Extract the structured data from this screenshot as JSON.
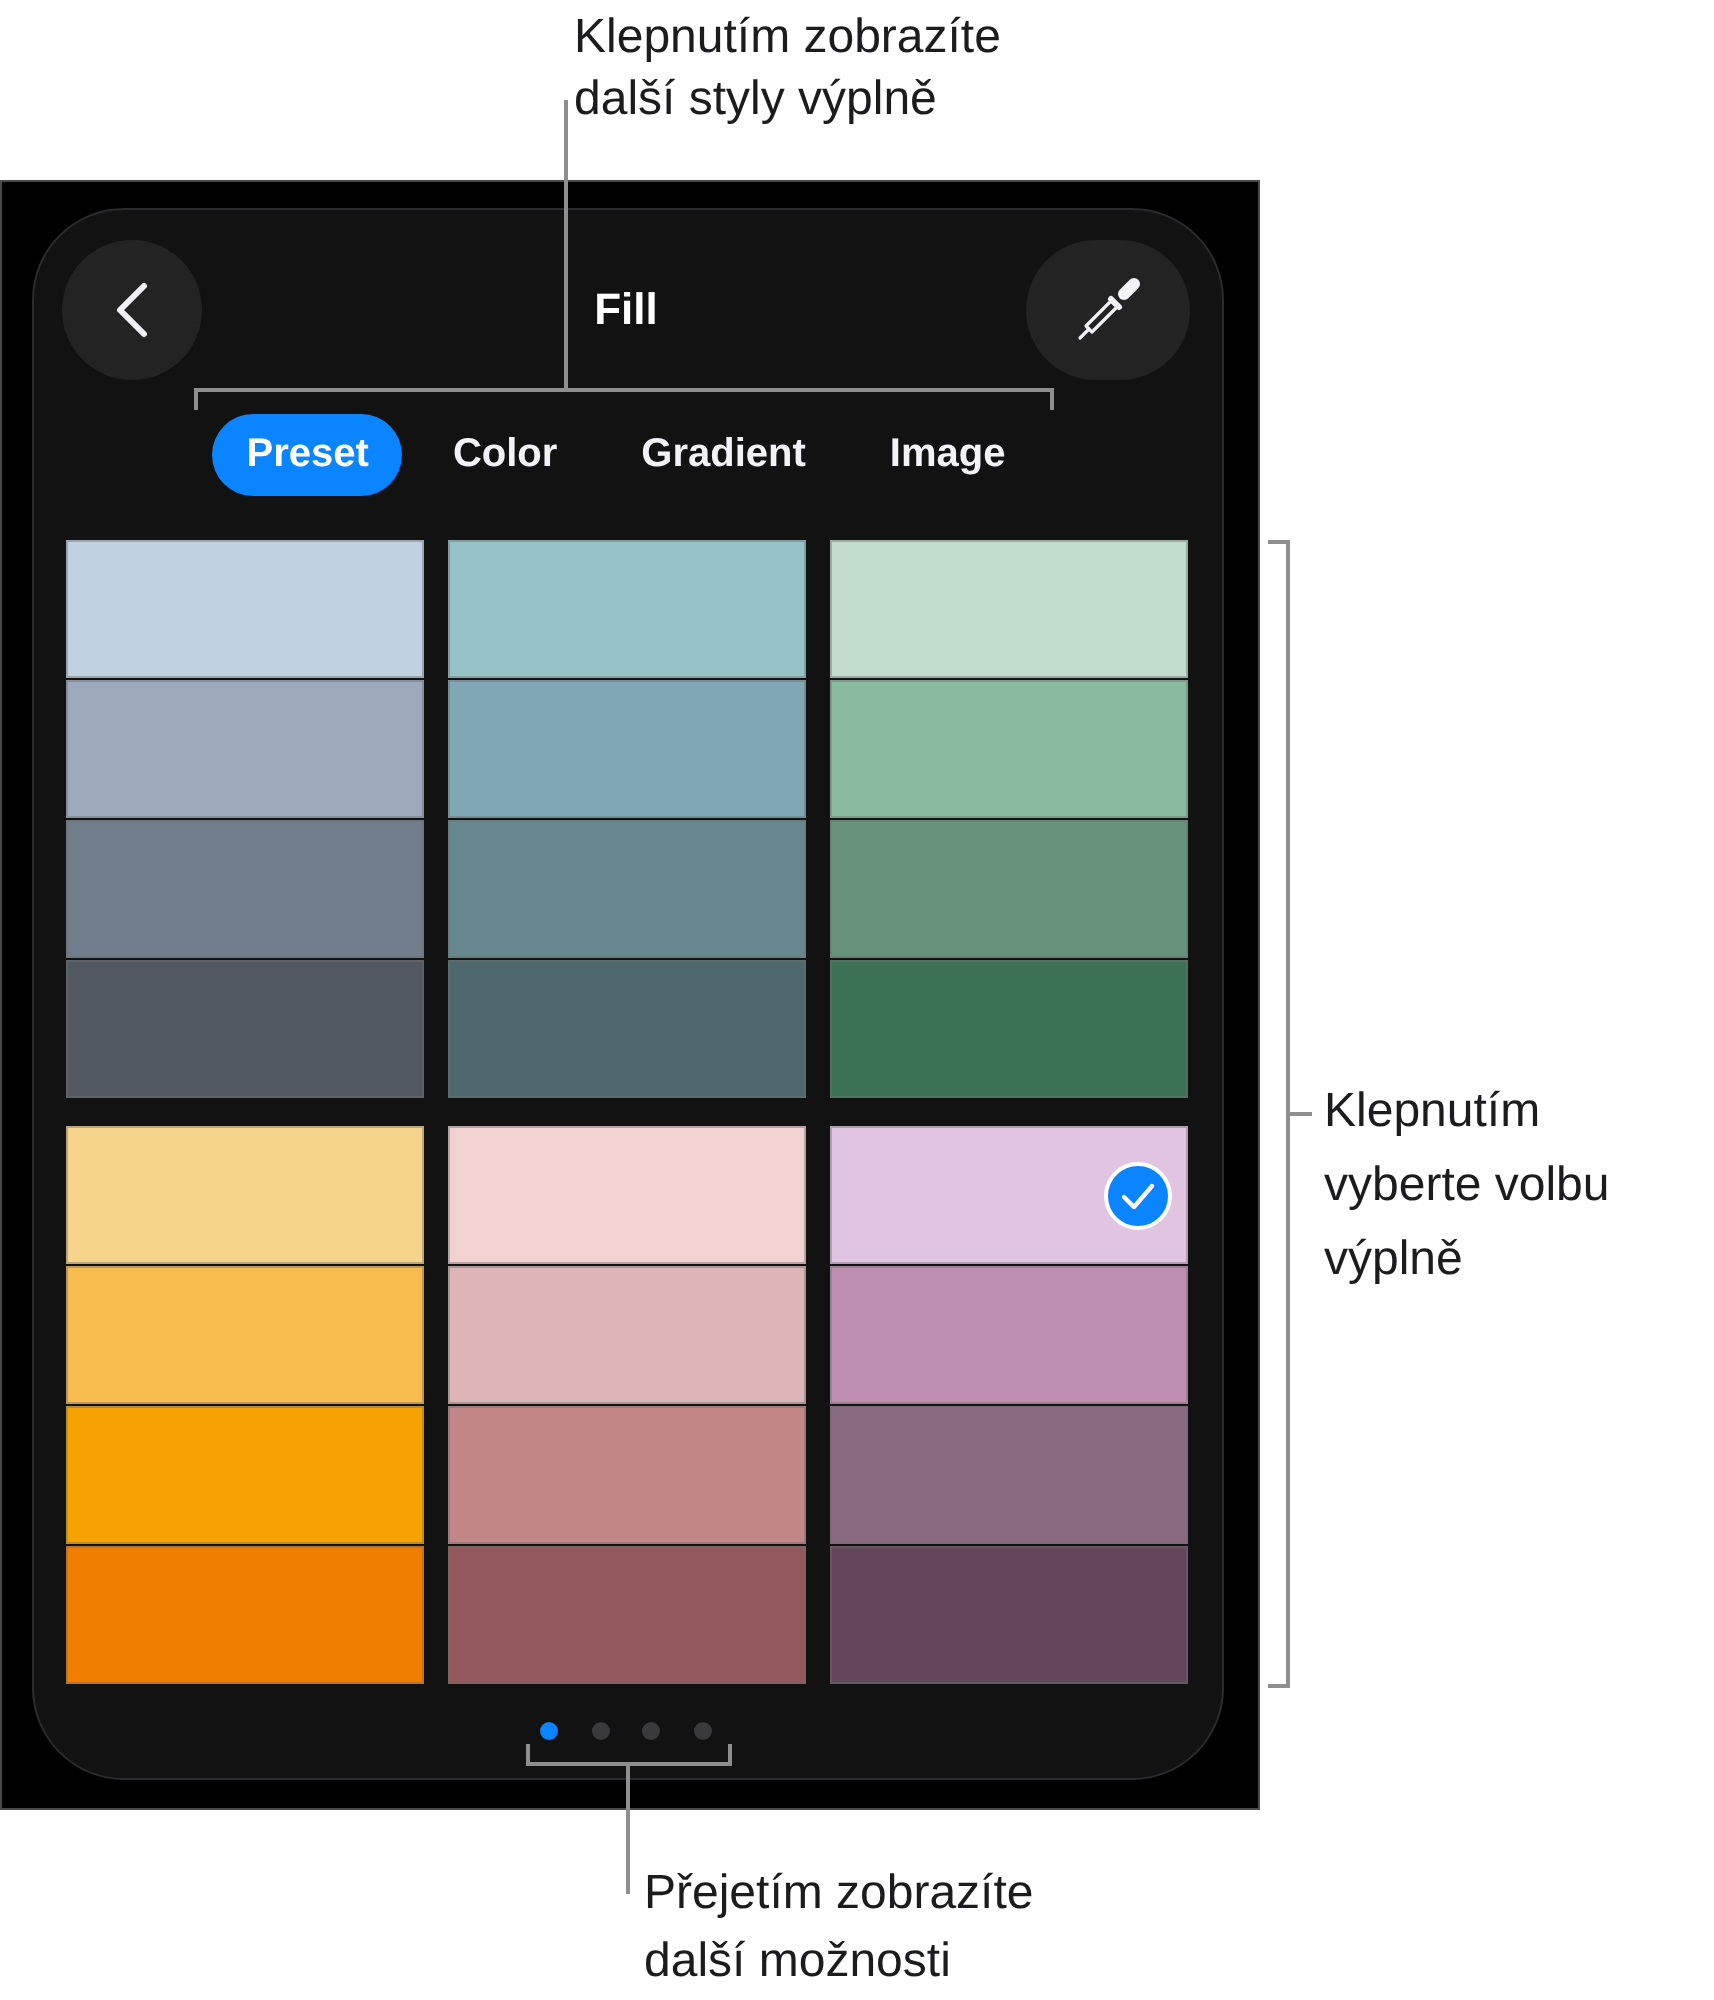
{
  "callouts": {
    "top": "Klepnutím zobrazíte další styly výplně",
    "right": "Klepnutím vyberte volbu výplně",
    "bottom": "Přejetím zobrazíte další možnosti"
  },
  "panel": {
    "title": "Fill",
    "tabs": [
      {
        "label": "Preset",
        "selected": true
      },
      {
        "label": "Color",
        "selected": false
      },
      {
        "label": "Gradient",
        "selected": false
      },
      {
        "label": "Image",
        "selected": false
      }
    ],
    "swatch_columns": [
      {
        "swatches": [
          {
            "color": "#c1d1e1",
            "selected": false
          },
          {
            "color": "#9daabb",
            "selected": false
          },
          {
            "color": "#727d8c",
            "selected": false
          },
          {
            "color": "#525860",
            "selected": false
          }
        ]
      },
      {
        "swatches": [
          {
            "color": "#95c3c8",
            "selected": false
          },
          {
            "color": "#7fa7b4",
            "selected": false
          },
          {
            "color": "#66878d",
            "selected": false
          },
          {
            "color": "#4e686e",
            "selected": false
          }
        ]
      },
      {
        "swatches": [
          {
            "color": "#c2ddcd",
            "selected": false
          },
          {
            "color": "#8aba9e",
            "selected": false
          },
          {
            "color": "#66937a",
            "selected": false
          },
          {
            "color": "#3c7254",
            "selected": false
          }
        ]
      },
      {
        "swatches": [
          {
            "color": "#f7d48c",
            "selected": false
          },
          {
            "color": "#f9bc4f",
            "selected": false
          },
          {
            "color": "#f6a200",
            "selected": false
          },
          {
            "color": "#f17e00",
            "selected": false
          }
        ]
      },
      {
        "swatches": [
          {
            "color": "#f2d1d1",
            "selected": false
          },
          {
            "color": "#dbb5b6",
            "selected": false
          },
          {
            "color": "#c38687",
            "selected": false
          },
          {
            "color": "#93595c",
            "selected": false
          }
        ]
      },
      {
        "swatches": [
          {
            "color": "#e1c4e2",
            "selected": true
          },
          {
            "color": "#be8fb1",
            "selected": false
          },
          {
            "color": "#8a6a80",
            "selected": false
          },
          {
            "color": "#62455b",
            "selected": false
          }
        ]
      }
    ],
    "page_dots": [
      {
        "selected": true
      },
      {
        "selected": false
      },
      {
        "selected": false
      },
      {
        "selected": false
      }
    ]
  }
}
